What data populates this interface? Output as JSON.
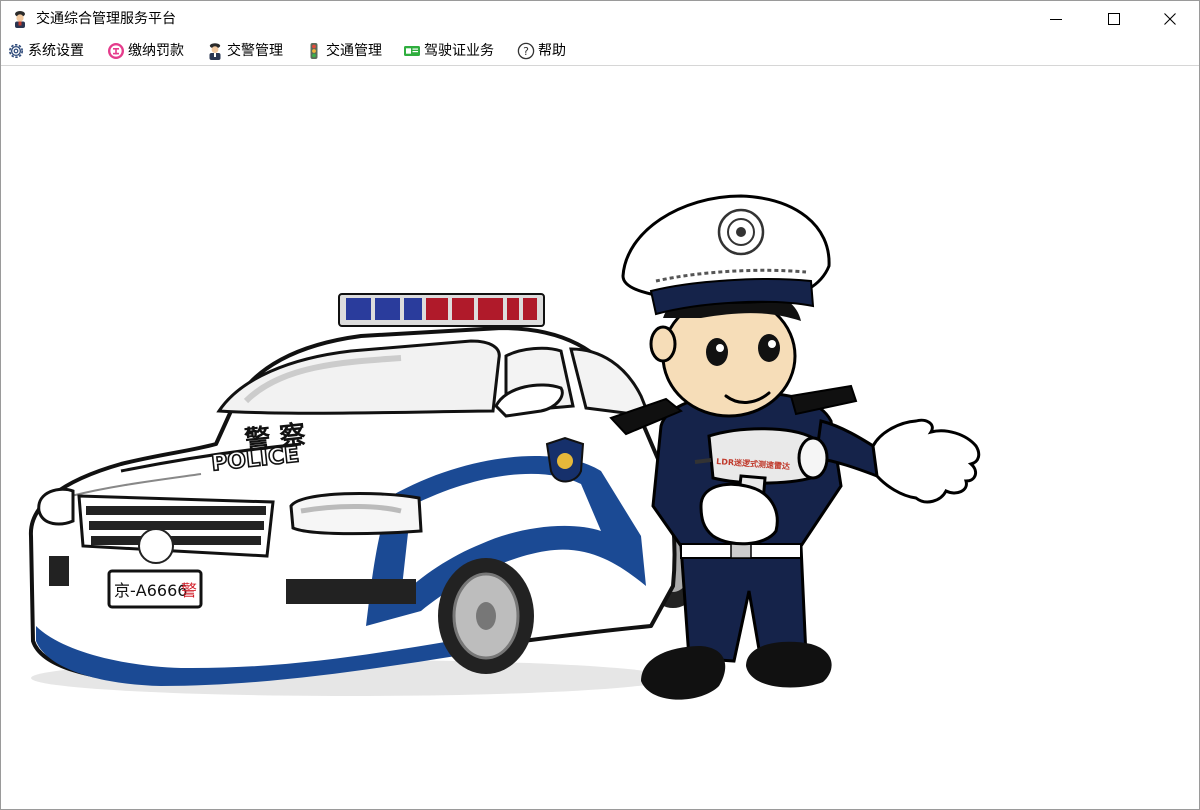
{
  "window": {
    "title": "交通综合管理服务平台",
    "icon": "police-officer-icon",
    "controls": [
      "minimize",
      "maximize",
      "close"
    ]
  },
  "menu": {
    "items": [
      {
        "label": "系统设置",
        "icon": "gear-icon"
      },
      {
        "label": "缴纳罚款",
        "icon": "violation-badge-icon"
      },
      {
        "label": "交警管理",
        "icon": "traffic-police-icon"
      },
      {
        "label": "交通管理",
        "icon": "traffic-light-icon"
      },
      {
        "label": "驾驶证业务",
        "icon": "license-card-icon"
      },
      {
        "label": "帮助",
        "icon": "help-icon"
      }
    ]
  },
  "illustration": {
    "car_door_text": "警 察",
    "car_police_text": "POLICE",
    "license_plate_prefix": "京-A6666",
    "license_plate_suffix": "警",
    "radar_gun_text": "LDR迷逻式测速雷达",
    "colors": {
      "police_blue": "#1b4a94",
      "uniform_navy": "#15234a",
      "light_red": "#b01a2a",
      "light_blue": "#2a3c9c"
    }
  }
}
